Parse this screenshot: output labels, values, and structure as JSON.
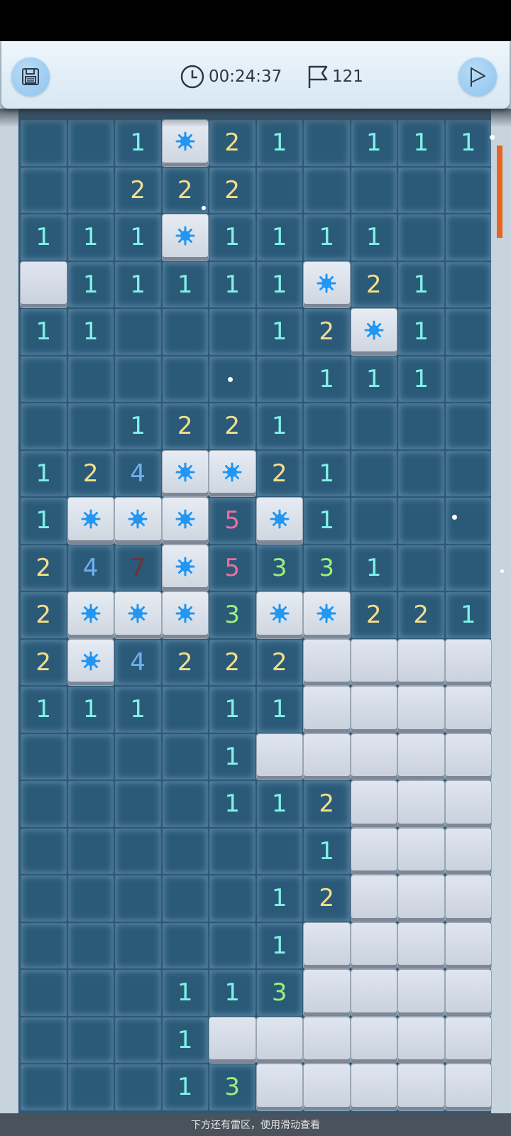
{
  "hud": {
    "timer": "00:24:37",
    "flags_remaining": "121",
    "save_icon": "save-icon",
    "clock_icon": "clock-icon",
    "flag_icon": "flag-icon",
    "play_icon": "play-flag-icon"
  },
  "colors": {
    "open_cell": "#2b5a79",
    "n1": "#7ef3e6",
    "n2": "#f5de8a",
    "n3": "#9bf07d",
    "n4": "#6eb1ef",
    "n5": "#f36b9d",
    "n7": "#7a2d2d",
    "mine_icon": "#2196f3"
  },
  "board": {
    "columns": 10,
    "legend": "\"\" = empty open cell, \"#\" = covered cell, \"*\" = revealed mine",
    "rows": [
      [
        "",
        "",
        "1",
        "*",
        "2",
        "1",
        "",
        "1",
        "1",
        "1"
      ],
      [
        "",
        "",
        "2",
        "2",
        "2",
        "",
        "",
        "",
        "",
        ""
      ],
      [
        "1",
        "1",
        "1",
        "*",
        "1",
        "1",
        "1",
        "1",
        "",
        ""
      ],
      [
        "#",
        "1",
        "1",
        "1",
        "1",
        "1",
        "*",
        "2",
        "1",
        ""
      ],
      [
        "1",
        "1",
        "",
        "",
        "",
        "1",
        "2",
        "*",
        "1",
        ""
      ],
      [
        "",
        "",
        "",
        "",
        "",
        "",
        "1",
        "1",
        "1",
        ""
      ],
      [
        "",
        "",
        "1",
        "2",
        "2",
        "1",
        "",
        "",
        "",
        ""
      ],
      [
        "1",
        "2",
        "4",
        "*",
        "*",
        "2",
        "1",
        "",
        "",
        ""
      ],
      [
        "1",
        "*",
        "*",
        "*",
        "5",
        "*",
        "1",
        "",
        "",
        ""
      ],
      [
        "2",
        "4",
        "7",
        "*",
        "5",
        "3",
        "3",
        "1",
        "",
        ""
      ],
      [
        "2",
        "*",
        "*",
        "*",
        "3",
        "*",
        "*",
        "2",
        "2",
        "1"
      ],
      [
        "2",
        "*",
        "4",
        "2",
        "2",
        "2",
        "#",
        "#",
        "#",
        "#"
      ],
      [
        "1",
        "1",
        "1",
        "",
        "1",
        "1",
        "#",
        "#",
        "#",
        "#"
      ],
      [
        "",
        "",
        "",
        "",
        "1",
        "#",
        "#",
        "#",
        "#",
        "#"
      ],
      [
        "",
        "",
        "",
        "",
        "1",
        "1",
        "2",
        "#",
        "#",
        "#"
      ],
      [
        "",
        "",
        "",
        "",
        "",
        "",
        "1",
        "#",
        "#",
        "#"
      ],
      [
        "",
        "",
        "",
        "",
        "",
        "1",
        "2",
        "#",
        "#",
        "#"
      ],
      [
        "",
        "",
        "",
        "",
        "",
        "1",
        "#",
        "#",
        "#",
        "#"
      ],
      [
        "",
        "",
        "",
        "1",
        "1",
        "3",
        "#",
        "#",
        "#",
        "#"
      ],
      [
        "",
        "",
        "",
        "1",
        "#",
        "#",
        "#",
        "#",
        "#",
        "#"
      ],
      [
        "",
        "",
        "",
        "1",
        "3",
        "#",
        "#",
        "#",
        "#",
        "#"
      ]
    ]
  },
  "hint_text": "下方还有雷区，使用滑动查看"
}
